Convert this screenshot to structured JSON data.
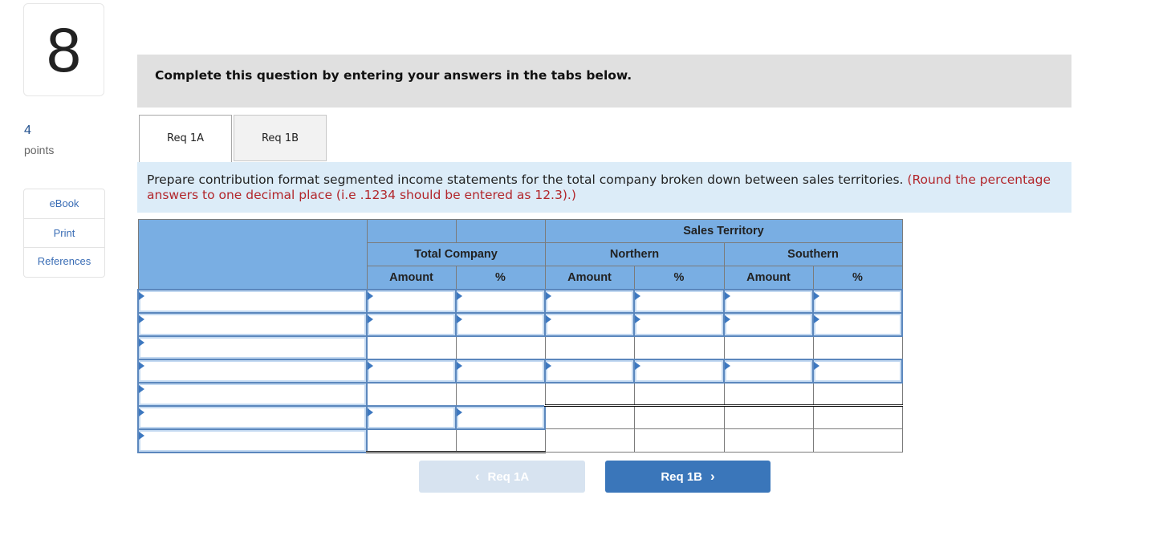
{
  "question": {
    "number": "8",
    "points_value": "4",
    "points_label": "points"
  },
  "side_links": [
    {
      "label": "eBook"
    },
    {
      "label": "Print"
    },
    {
      "label": "References"
    }
  ],
  "banner": {
    "text": "Complete this question by entering your answers in the tabs below."
  },
  "tabs": [
    {
      "label": "Req 1A",
      "active": true
    },
    {
      "label": "Req 1B",
      "active": false
    }
  ],
  "instructions": {
    "text": "Prepare contribution format segmented income statements for the total company broken down between sales territories. ",
    "note": "(Round the percentage answers to one decimal place (i.e .1234 should be entered as 12.3).)"
  },
  "table": {
    "group_header": "Sales Territory",
    "section_headers": [
      "Total Company",
      "Northern",
      "Southern"
    ],
    "column_headers": [
      "Amount",
      "%",
      "Amount",
      "%",
      "Amount",
      "%"
    ],
    "rows": [
      {
        "label": "",
        "values": [
          "",
          "",
          "",
          "",
          "",
          ""
        ]
      },
      {
        "label": "",
        "values": [
          "",
          "",
          "",
          "",
          "",
          ""
        ]
      },
      {
        "label": "",
        "values": [
          "",
          "",
          "",
          "",
          "",
          ""
        ]
      },
      {
        "label": "",
        "values": [
          "",
          "",
          "",
          "",
          "",
          ""
        ]
      },
      {
        "label": "",
        "values": [
          "",
          "",
          "",
          "",
          "",
          ""
        ]
      },
      {
        "label": "",
        "values": [
          "",
          "",
          "",
          "",
          "",
          ""
        ]
      },
      {
        "label": "",
        "values": [
          "",
          "",
          "",
          "",
          "",
          ""
        ]
      }
    ]
  },
  "navigation": {
    "prev_label": "Req 1A",
    "next_label": "Req 1B",
    "prev_icon": "chevron-left-icon",
    "next_icon": "chevron-right-icon"
  },
  "colors": {
    "header_blue": "#79aee3",
    "input_border": "#5b87bd",
    "next_button": "#3a76ba",
    "prev_button_disabled": "#d7e3f0",
    "instruction_bg": "#dcecf8",
    "note_red": "#b2262b"
  }
}
